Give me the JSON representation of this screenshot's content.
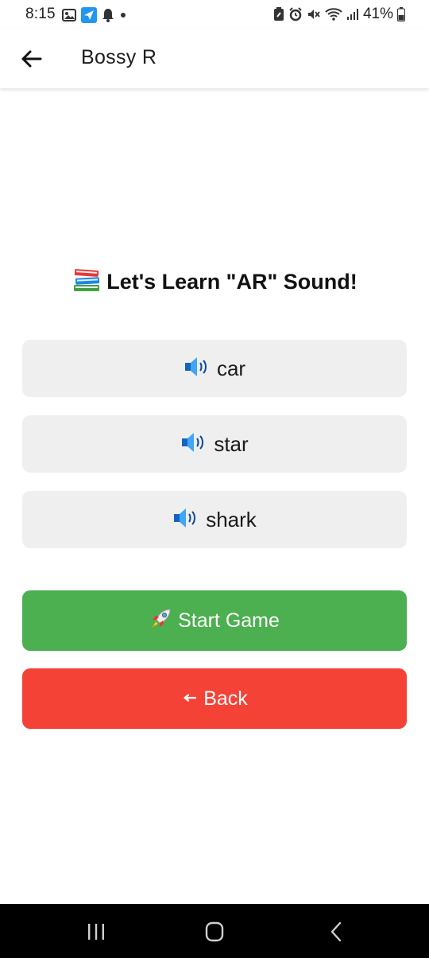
{
  "status_bar": {
    "time": "8:15",
    "battery_percent": "41%",
    "left_icons": [
      "gallery-icon",
      "app-notification-icon",
      "bell-icon",
      "dot-icon"
    ],
    "right_icons": [
      "battery-saver-icon",
      "alarm-icon",
      "mute-icon",
      "wifi-icon",
      "signal-icon",
      "battery-icon"
    ]
  },
  "app_bar": {
    "title": "Bossy R",
    "back_icon": "arrow-left-icon"
  },
  "content": {
    "heading_icon": "books-icon",
    "heading": "Let's Learn \"AR\" Sound!",
    "words": [
      {
        "label": "car",
        "icon": "speaker-icon"
      },
      {
        "label": "star",
        "icon": "speaker-icon"
      },
      {
        "label": "shark",
        "icon": "speaker-icon"
      }
    ],
    "start_button": {
      "icon": "rocket-icon",
      "label": "Start Game",
      "color": "#4caf50"
    },
    "back_button": {
      "icon": "arrow-left-small-icon",
      "label": "Back",
      "color": "#f44336"
    }
  },
  "nav_bar": {
    "buttons": [
      "recent-apps-icon",
      "home-icon",
      "back-nav-icon"
    ]
  },
  "colors": {
    "word_button_bg": "#efefef",
    "nav_bar_bg": "#000000",
    "speaker_blue": "#1e88e5"
  }
}
